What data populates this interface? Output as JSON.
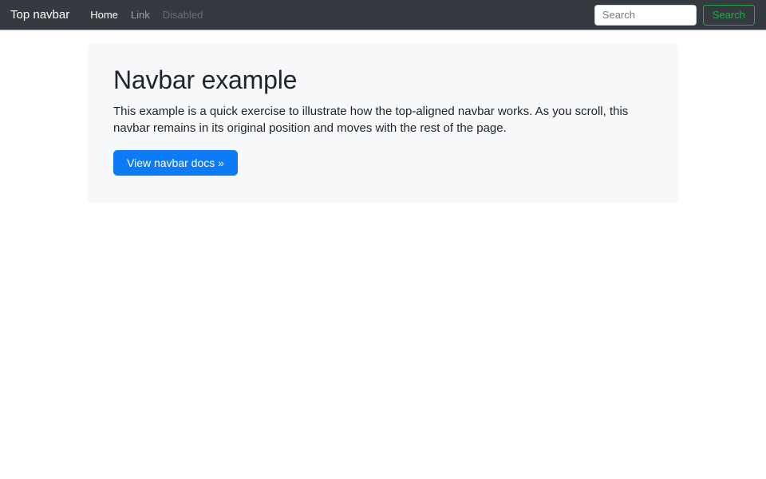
{
  "navbar": {
    "brand": "Top navbar",
    "links": [
      {
        "label": "Home",
        "state": "active"
      },
      {
        "label": "Link",
        "state": "normal"
      },
      {
        "label": "Disabled",
        "state": "disabled"
      }
    ],
    "search": {
      "placeholder": "Search",
      "button_label": "Search"
    }
  },
  "jumbotron": {
    "title": "Navbar example",
    "description": "This example is a quick exercise to illustrate how the top-aligned navbar works. As you scroll, this navbar remains in its original position and moves with the rest of the page.",
    "cta_label": "View navbar docs »"
  },
  "colors": {
    "navbar_bg": "#343a40",
    "navbar_link_active": "#ffffff",
    "navbar_link_normal": "rgba(255,255,255,0.5)",
    "navbar_link_disabled": "rgba(255,255,255,0.25)",
    "jumbotron_bg": "#f6f8f9",
    "primary_button": "#0d7bf5",
    "success_outline": "#28a745",
    "text": "#212529"
  }
}
